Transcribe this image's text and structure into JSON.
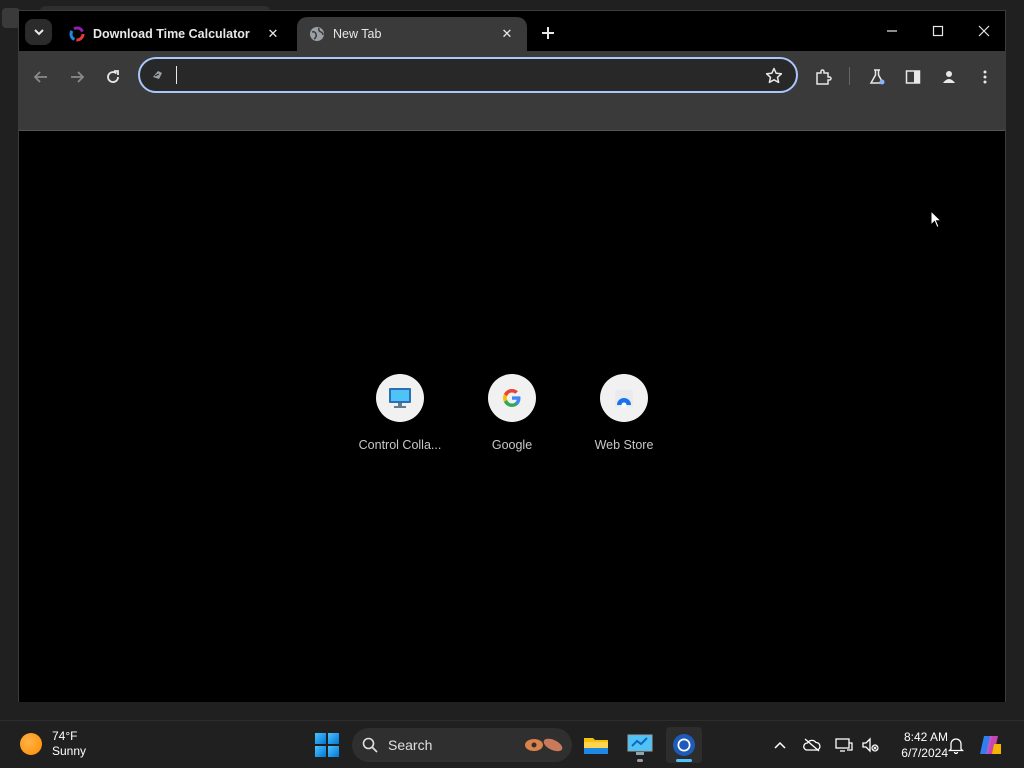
{
  "browser": {
    "tabs": [
      {
        "title": "Download Time Calculator",
        "active": false,
        "favicon": "ring-logo-icon"
      },
      {
        "title": "New Tab",
        "active": true,
        "favicon": "globe-icon"
      }
    ],
    "omnibox": {
      "value": "",
      "placeholder": ""
    }
  },
  "new_tab_page": {
    "shortcuts": [
      {
        "label": "Control Colla...",
        "icon": "monitor-icon"
      },
      {
        "label": "Google",
        "icon": "google-g-icon"
      },
      {
        "label": "Web Store",
        "icon": "web-store-icon"
      }
    ]
  },
  "taskbar": {
    "weather": {
      "temp": "74°F",
      "condition": "Sunny"
    },
    "search_label": "Search",
    "clock": {
      "time": "8:42 AM",
      "date": "6/7/2024"
    }
  },
  "colors": {
    "accent": "#a8c7fa",
    "toolbar": "#3a3a3a",
    "page_bg": "#000000",
    "taskbar": "#202020"
  }
}
